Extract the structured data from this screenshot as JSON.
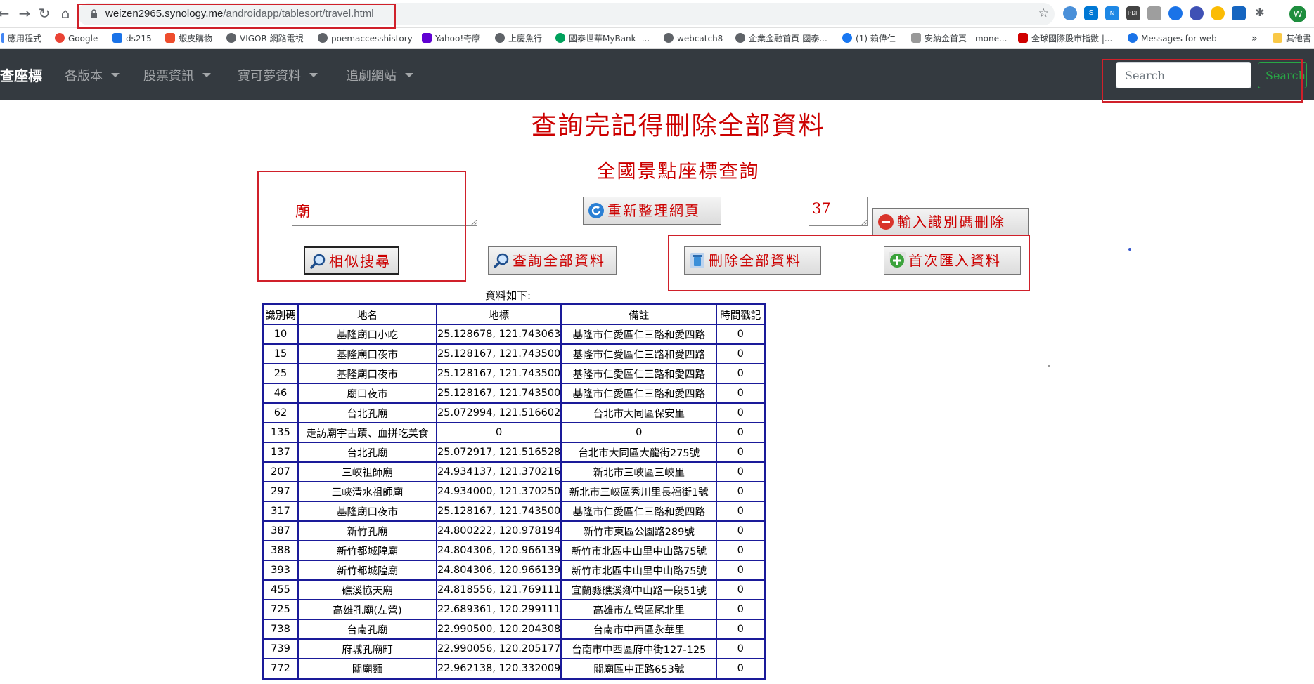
{
  "browser": {
    "url_host": "weizen2965.synology.me",
    "url_path": "/androidapp/tablesort/travel.html"
  },
  "bookmarks": [
    {
      "label": "應用程式",
      "color": "#4285f4"
    },
    {
      "label": "Google",
      "color": "#ea4335"
    },
    {
      "label": "ds215",
      "color": "#1a73e8"
    },
    {
      "label": "蝦皮購物",
      "color": "#ee4d2d"
    },
    {
      "label": "VIGOR 網路電視",
      "color": "#5f6368"
    },
    {
      "label": "poemaccesshistory",
      "color": "#5f6368"
    },
    {
      "label": "Yahoo!奇摩",
      "color": "#6001d2"
    },
    {
      "label": "上慶魚行",
      "color": "#5f6368"
    },
    {
      "label": "國泰世華MyBank -...",
      "color": "#00a15c"
    },
    {
      "label": "webcatch8",
      "color": "#5f6368"
    },
    {
      "label": "企業金融首頁-國泰...",
      "color": "#5f6368"
    },
    {
      "label": "(1) 賴偉仁",
      "color": "#1877f2"
    },
    {
      "label": "安納金首頁 - mone...",
      "color": "#999999"
    },
    {
      "label": "全球國際股市指數 |...",
      "color": "#d00000"
    },
    {
      "label": "Messages for web",
      "color": "#1a73e8"
    }
  ],
  "bookmarks_other": "其他書",
  "navbar": {
    "brand": "查座標",
    "items": [
      "各版本",
      "股票資訊",
      "寶可夢資料",
      "追劇網站"
    ],
    "search_placeholder": "Search",
    "search_button": "Search"
  },
  "page": {
    "title": "查詢完記得刪除全部資料",
    "subtitle": "全國景點座標查詢",
    "keyword_value": "廟",
    "id_value": "37",
    "buttons": {
      "refresh": "重新整理網頁",
      "delete_by_id": "輸入識別碼刪除",
      "similar_search": "相似搜尋",
      "query_all": "查詢全部資料",
      "delete_all": "刪除全部資料",
      "first_import": "首次匯入資料"
    },
    "caption": "資料如下:"
  },
  "table": {
    "headers": [
      "識別碼",
      "地名",
      "地標",
      "備註",
      "時間戳記"
    ],
    "rows": [
      [
        "10",
        "基隆廟口小吃",
        "25.128678, 121.743063",
        "基隆市仁愛區仁三路和愛四路",
        "0"
      ],
      [
        "15",
        "基隆廟口夜市",
        "25.128167, 121.743500",
        "基隆市仁愛區仁三路和愛四路",
        "0"
      ],
      [
        "25",
        "基隆廟口夜市",
        "25.128167, 121.743500",
        "基隆市仁愛區仁三路和愛四路",
        "0"
      ],
      [
        "46",
        "廟口夜市",
        "25.128167, 121.743500",
        "基隆市仁愛區仁三路和愛四路",
        "0"
      ],
      [
        "62",
        "台北孔廟",
        "25.072994, 121.516602",
        "台北市大同區保安里",
        "0"
      ],
      [
        "135",
        "走訪廟宇古蹟、血拼吃美食",
        "0",
        "0",
        "0"
      ],
      [
        "137",
        "台北孔廟",
        "25.072917, 121.516528",
        "台北市大同區大龍街275號",
        "0"
      ],
      [
        "207",
        "三峽祖師廟",
        "24.934137, 121.370216",
        "新北市三峽區三峽里",
        "0"
      ],
      [
        "297",
        "三峽清水祖師廟",
        "24.934000, 121.370250",
        "新北市三峽區秀川里長福街1號",
        "0"
      ],
      [
        "317",
        "基隆廟口夜市",
        "25.128167, 121.743500",
        "基隆市仁愛區仁三路和愛四路",
        "0"
      ],
      [
        "387",
        "新竹孔廟",
        "24.800222, 120.978194",
        "新竹市東區公園路289號",
        "0"
      ],
      [
        "388",
        "新竹都城隍廟",
        "24.804306, 120.966139",
        "新竹市北區中山里中山路75號",
        "0"
      ],
      [
        "393",
        "新竹都城隍廟",
        "24.804306, 120.966139",
        "新竹市北區中山里中山路75號",
        "0"
      ],
      [
        "455",
        "礁溪協天廟",
        "24.818556, 121.769111",
        "宜蘭縣礁溪鄉中山路一段51號",
        "0"
      ],
      [
        "725",
        "高雄孔廟(左營)",
        "22.689361, 120.299111",
        "高雄市左營區尾北里",
        "0"
      ],
      [
        "738",
        "台南孔廟",
        "22.990500, 120.204308",
        "台南市中西區永華里",
        "0"
      ],
      [
        "739",
        "府城孔廟町",
        "22.990056, 120.205177",
        "台南市中西區府中街127-125",
        "0"
      ],
      [
        "772",
        "關廟麵",
        "22.962138, 120.332009",
        "關廟區中正路653號",
        "0"
      ]
    ]
  },
  "colors": {
    "accent_red": "#cc0000",
    "navbar_bg": "#343a40",
    "table_border": "#1a1a99",
    "highlight": "#d0202a"
  }
}
